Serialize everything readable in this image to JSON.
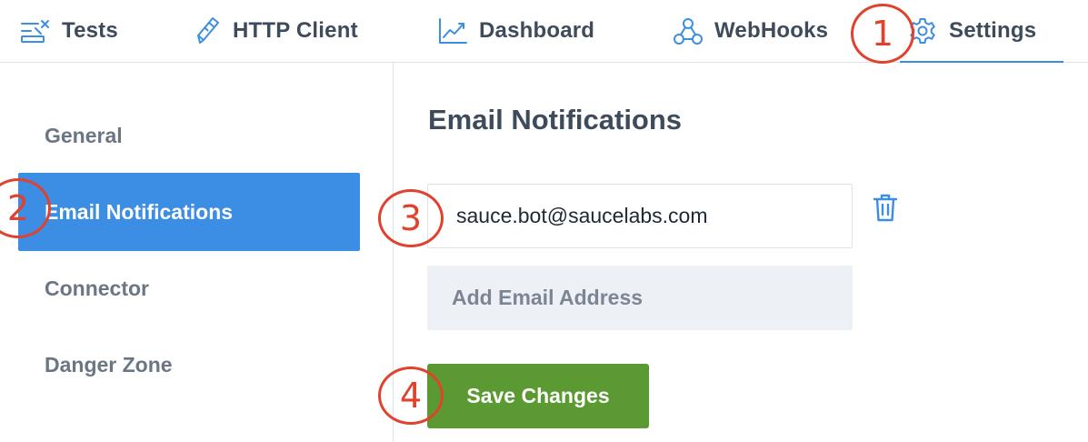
{
  "topnav": {
    "tabs": [
      {
        "label": "Tests",
        "icon": "checklist-icon",
        "active": false
      },
      {
        "label": "HTTP Client",
        "icon": "pencil-icon",
        "active": false
      },
      {
        "label": "Dashboard",
        "icon": "line-chart-icon",
        "active": false
      },
      {
        "label": "WebHooks",
        "icon": "webhook-icon",
        "active": false
      },
      {
        "label": "Settings",
        "icon": "gear-icon",
        "active": true
      }
    ]
  },
  "sidebar": {
    "items": [
      {
        "label": "General",
        "active": false
      },
      {
        "label": "Email Notifications",
        "active": true
      },
      {
        "label": "Connector",
        "active": false
      },
      {
        "label": "Danger Zone",
        "active": false
      }
    ]
  },
  "main": {
    "title": "Email Notifications",
    "email_value": "sauce.bot@saucelabs.com",
    "delete_icon": "trash-icon",
    "add_email_label": "Add Email Address",
    "save_label": "Save Changes"
  },
  "annotations": {
    "markers": [
      "1",
      "2",
      "3",
      "4"
    ]
  },
  "colors": {
    "accent": "#3b8ee3",
    "save": "#5b9a32",
    "marker": "#e0422d",
    "text": "#3e4b5b",
    "muted": "#6b7685"
  }
}
